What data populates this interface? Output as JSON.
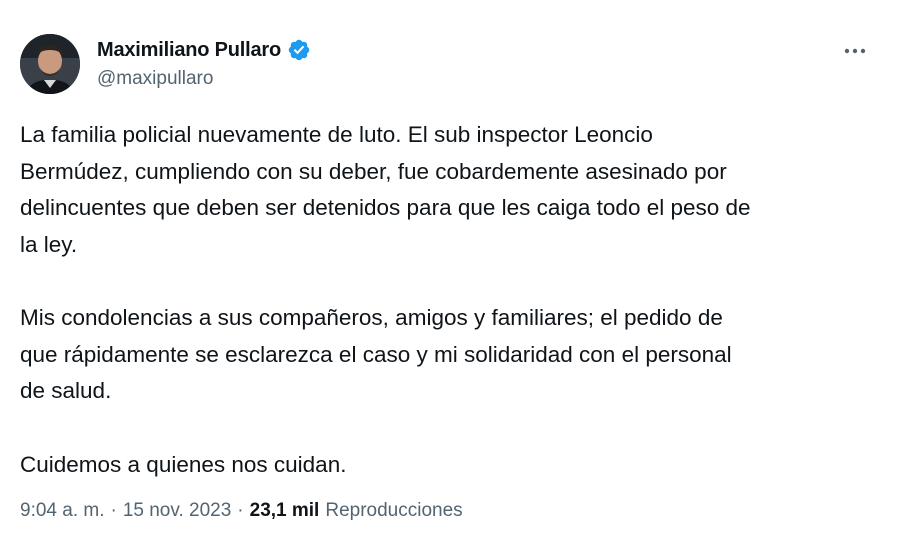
{
  "author": {
    "display_name": "Maximiliano Pullaro",
    "handle": "@maxipullaro",
    "verified": true,
    "verified_color": "#1d9bf0"
  },
  "tweet": {
    "paragraphs": [
      "La familia policial nuevamente de luto. El sub inspector Leoncio\nBermúdez, cumpliendo con su deber, fue cobardemente asesinado por\ndelincuentes que deben ser detenidos para que les caiga todo el peso de\nla ley.",
      "Mis condolencias a sus compañeros, amigos y familiares; el pedido de\nque rápidamente se esclarezca el caso y mi solidaridad con el personal\nde salud.",
      "Cuidemos a quienes nos cuidan."
    ]
  },
  "meta": {
    "time": "9:04 a. m.",
    "separator": "·",
    "date": "15 nov. 2023",
    "views_count": "23,1 mil",
    "views_label": "Reproducciones"
  },
  "icons": {
    "more": "more-horizontal-icon",
    "verified": "verified-badge-icon"
  }
}
